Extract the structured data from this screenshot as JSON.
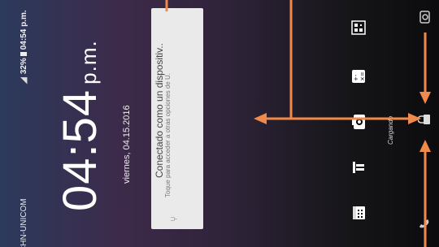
{
  "status_bar": {
    "carrier": "CHN-UNICOM",
    "battery": "32%",
    "time": "04:54 p.m."
  },
  "clock": {
    "time": "04:54",
    "ampm": "p.m."
  },
  "date": "viernes, 04.15.2016",
  "notification": {
    "title": "Conectado como un dispositiv..",
    "subtitle": "Toque para acceder a otras opciones de U."
  },
  "charging_text": "Cargando",
  "shortcuts": [
    "qr-scanner-icon",
    "calculator-icon",
    "camera-icon",
    "flashlight-icon",
    "calendar-icon"
  ],
  "lock_bar": [
    "camera-icon",
    "lock-icon",
    "phone-icon"
  ],
  "colors": {
    "annotation_arrow": "#f08a4b",
    "notification_bg": "#eaeaea"
  }
}
